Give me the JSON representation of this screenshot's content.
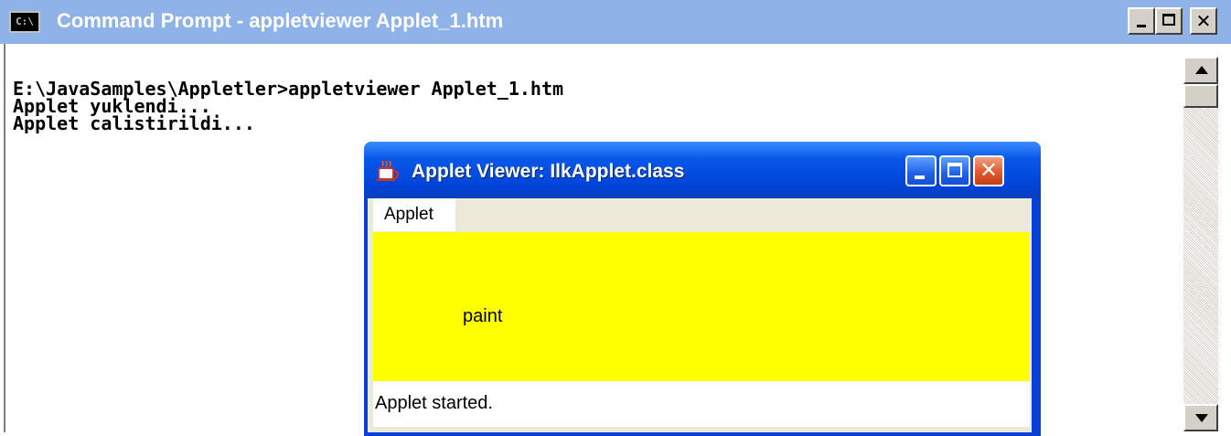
{
  "cmd_window": {
    "title": "Command Prompt - appletviewer Applet_1.htm",
    "icon_text": "C:\\",
    "console_lines": [
      "E:\\JavaSamples\\Appletler>appletviewer Applet_1.htm",
      "Applet yuklendi...",
      "Applet calistirildi..."
    ]
  },
  "applet_window": {
    "title": "Applet Viewer: IlkApplet.class",
    "menu": [
      "Applet"
    ],
    "canvas_text": "paint",
    "canvas_color": "#ffff00",
    "status": "Applet started."
  },
  "colors": {
    "cmd_titlebar": "#8fb3e8",
    "xp_titlebar": "#0058e6",
    "xp_close": "#e0582e"
  },
  "icons": {
    "cmd": "console-icon",
    "applet": "java-cup-icon",
    "minimize": "minimize-icon",
    "maximize": "maximize-icon",
    "close": "close-icon",
    "scroll_up": "arrow-up-icon",
    "scroll_down": "arrow-down-icon"
  }
}
